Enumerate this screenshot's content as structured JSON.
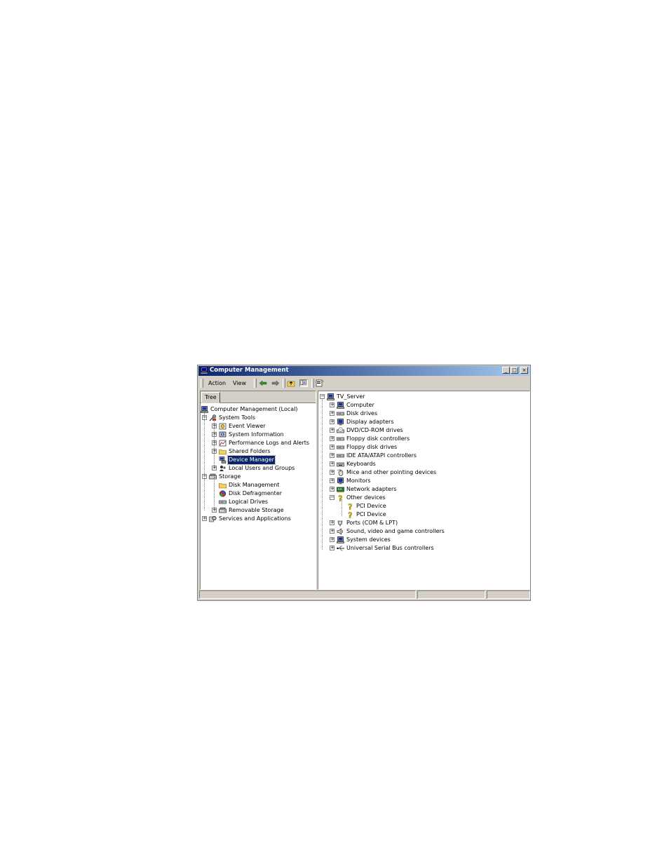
{
  "window": {
    "title": "Computer Management"
  },
  "toolbar": {
    "action": "Action",
    "view": "View"
  },
  "left": {
    "tab": "Tree",
    "nodes": [
      {
        "label": "Computer Management (Local)",
        "icon": "computer-icon",
        "expander": ""
      },
      {
        "label": "System Tools",
        "icon": "tools-icon",
        "expander": "−"
      },
      {
        "label": "Event Viewer",
        "icon": "event-viewer-icon",
        "expander": "+"
      },
      {
        "label": "System Information",
        "icon": "system-info-icon",
        "expander": "+"
      },
      {
        "label": "Performance Logs and Alerts",
        "icon": "performance-icon",
        "expander": "+"
      },
      {
        "label": "Shared Folders",
        "icon": "shared-folder-icon",
        "expander": "+"
      },
      {
        "label": "Device Manager",
        "icon": "device-manager-icon",
        "expander": "",
        "selected": true
      },
      {
        "label": "Local Users and Groups",
        "icon": "users-icon",
        "expander": "+"
      },
      {
        "label": "Storage",
        "icon": "storage-icon",
        "expander": "−"
      },
      {
        "label": "Disk Management",
        "icon": "disk-management-icon",
        "expander": ""
      },
      {
        "label": "Disk Defragmenter",
        "icon": "defragmenter-icon",
        "expander": ""
      },
      {
        "label": "Logical Drives",
        "icon": "logical-drive-icon",
        "expander": ""
      },
      {
        "label": "Removable Storage",
        "icon": "removable-storage-icon",
        "expander": "+"
      },
      {
        "label": "Services and Applications",
        "icon": "services-icon",
        "expander": "+"
      }
    ]
  },
  "right": {
    "root": {
      "label": "TV_Server",
      "icon": "computer-icon",
      "expander": "−"
    },
    "nodes": [
      {
        "label": "Computer",
        "icon": "computer-icon",
        "expander": "+"
      },
      {
        "label": "Disk drives",
        "icon": "disk-drive-icon",
        "expander": "+"
      },
      {
        "label": "Display adapters",
        "icon": "display-adapter-icon",
        "expander": "+"
      },
      {
        "label": "DVD/CD-ROM drives",
        "icon": "cdrom-icon",
        "expander": "+"
      },
      {
        "label": "Floppy disk controllers",
        "icon": "floppy-controller-icon",
        "expander": "+"
      },
      {
        "label": "Floppy disk drives",
        "icon": "floppy-drive-icon",
        "expander": "+"
      },
      {
        "label": "IDE ATA/ATAPI controllers",
        "icon": "ide-controller-icon",
        "expander": "+"
      },
      {
        "label": "Keyboards",
        "icon": "keyboard-icon",
        "expander": "+"
      },
      {
        "label": "Mice and other pointing devices",
        "icon": "mouse-icon",
        "expander": "+"
      },
      {
        "label": "Monitors",
        "icon": "monitor-icon",
        "expander": "+"
      },
      {
        "label": "Network adapters",
        "icon": "network-adapter-icon",
        "expander": "+"
      },
      {
        "label": "Other devices",
        "icon": "unknown-device-icon",
        "expander": "−"
      },
      {
        "label": "PCI Device",
        "icon": "unknown-device-icon",
        "expander": ""
      },
      {
        "label": "PCI Device",
        "icon": "unknown-device-icon",
        "expander": ""
      },
      {
        "label": "Ports (COM & LPT)",
        "icon": "port-icon",
        "expander": "+"
      },
      {
        "label": "Sound, video and game controllers",
        "icon": "sound-icon",
        "expander": "+"
      },
      {
        "label": "System devices",
        "icon": "system-device-icon",
        "expander": "+"
      },
      {
        "label": "Universal Serial Bus controllers",
        "icon": "usb-icon",
        "expander": "+"
      }
    ]
  },
  "colors": {
    "titlebar_start": "#0a246a",
    "titlebar_end": "#a6caf0",
    "face": "#d4d0c8",
    "selection": "#0a246a"
  }
}
